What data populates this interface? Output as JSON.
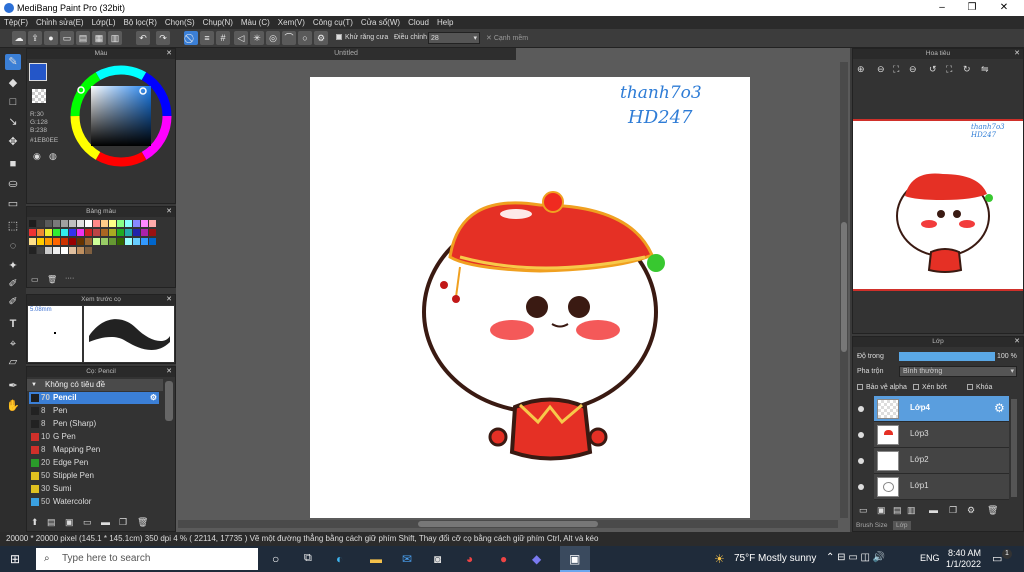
{
  "window": {
    "title": "MediBang Paint Pro (32bit)",
    "minimize": "–",
    "maximize": "❐",
    "close": "✕"
  },
  "menu": [
    "Tệp(F)",
    "Chỉnh sửa(E)",
    "Lớp(L)",
    "Bộ lọc(R)",
    "Chọn(S)",
    "Chụp(N)",
    "Màu (C)",
    "Xem(V)",
    "Công cụ(T)",
    "Cửa sổ(W)",
    "Cloud",
    "Help"
  ],
  "toolbar": {
    "antialias_label": "Khử răng cưa",
    "correction_label": "Điều chỉnh",
    "correction_value": "28",
    "soft_edge_label": "Cạnh mềm"
  },
  "color_panel": {
    "title": "Màu",
    "r": "R:30",
    "g": "G:128",
    "b": "B:238",
    "hex": "#1EB0EE"
  },
  "palette_panel": {
    "title": "Bảng màu",
    "more": "····"
  },
  "brush_preview": {
    "title": "Xem trước cọ",
    "size": "5.08mm"
  },
  "brush_panel": {
    "title": "Cọ: Pencil",
    "group": "Không có tiêu đề",
    "brushes": [
      {
        "size": "70",
        "name": "Pencil",
        "color": "#1e1e1e",
        "selected": true
      },
      {
        "size": "8",
        "name": "Pen",
        "color": "#222222"
      },
      {
        "size": "8",
        "name": "Pen (Sharp)",
        "color": "#222222"
      },
      {
        "size": "10",
        "name": "G Pen",
        "color": "#d0302a"
      },
      {
        "size": "8",
        "name": "Mapping Pen",
        "color": "#d0302a"
      },
      {
        "size": "20",
        "name": "Edge Pen",
        "color": "#2a9a2a"
      },
      {
        "size": "50",
        "name": "Stipple Pen",
        "color": "#e0c020"
      },
      {
        "size": "30",
        "name": "Sumi",
        "color": "#e0c020"
      },
      {
        "size": "50",
        "name": "Watercolor",
        "color": "#3aa0e0"
      }
    ]
  },
  "canvas": {
    "tab": "Untitled",
    "signature_line1": "thanh7o3",
    "signature_line2": "HD247"
  },
  "navigator": {
    "title": "Hoa tiêu"
  },
  "layers_panel": {
    "title": "Lớp",
    "opacity_label": "Độ trong",
    "opacity_value": "100 %",
    "blend_label": "Pha trộn",
    "blend_value": "Bình thường",
    "protect_alpha": "Bảo vệ alpha",
    "clipping": "Xén bớt",
    "lock": "Khóa",
    "layers": [
      "Lớp4",
      "Lớp3",
      "Lớp2",
      "Lớp1"
    ],
    "tabs": [
      "Brush Size",
      "Lớp"
    ]
  },
  "status": {
    "text": "20000 * 20000 pixel   (145.1 * 145.1cm)  350 dpi   4 %   ( 22114, 17735 )   Vẽ một đường thẳng bằng cách giữ phím Shift, Thay đổi cỡ cọ bằng cách giữ phím Ctrl, Alt và kéo"
  },
  "taskbar": {
    "search_placeholder": "Type here to search",
    "weather": "75°F  Mostly sunny",
    "lang": "ENG",
    "time": "8:40 AM",
    "date": "1/1/2022",
    "notif": "1"
  },
  "colors": {
    "accent": "#3b7fd6",
    "main_color": "#1EB0EE"
  }
}
